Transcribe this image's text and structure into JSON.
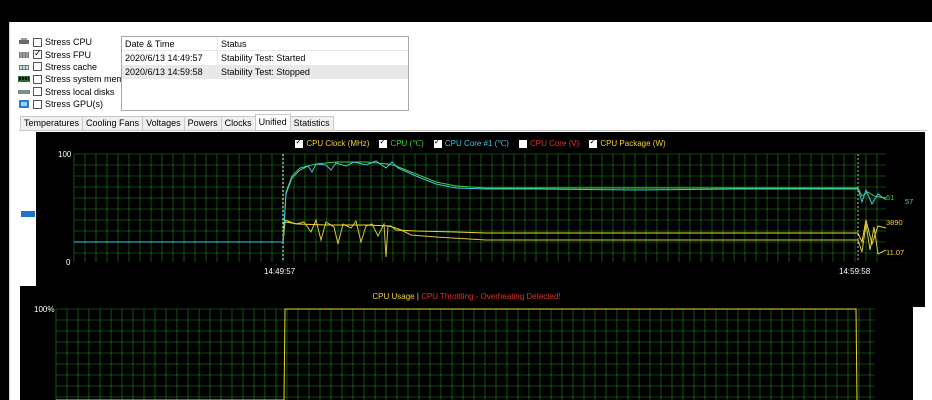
{
  "stress": [
    {
      "label": "Stress CPU",
      "checked": false,
      "icon": "cpu-icon"
    },
    {
      "label": "Stress FPU",
      "checked": true,
      "icon": "fpu-icon"
    },
    {
      "label": "Stress cache",
      "checked": false,
      "icon": "cache-icon"
    },
    {
      "label": "Stress system memo",
      "checked": false,
      "icon": "memory-icon"
    },
    {
      "label": "Stress local disks",
      "checked": false,
      "icon": "disk-icon"
    },
    {
      "label": "Stress GPU(s)",
      "checked": false,
      "icon": "gpu-icon"
    }
  ],
  "log": {
    "headers": [
      "Date & Time",
      "Status"
    ],
    "rows": [
      {
        "time": "2020/6/13 14:49:57",
        "status": "Stability Test: Started"
      },
      {
        "time": "2020/6/13 14:59:58",
        "status": "Stability Test: Stopped"
      }
    ]
  },
  "tabs": [
    "Temperatures",
    "Cooling Fans",
    "Voltages",
    "Powers",
    "Clocks",
    "Unified",
    "Statistics"
  ],
  "active_tab": "Unified",
  "chart1": {
    "legend": [
      {
        "label": "CPU Clock (MHz)",
        "color": "#f2d431",
        "checked": true
      },
      {
        "label": "CPU (℃)",
        "color": "#3fd13f",
        "checked": true
      },
      {
        "label": "CPU Core #1 (℃)",
        "color": "#42c6e8",
        "checked": true
      },
      {
        "label": "CPU Core (V)",
        "color": "#e0332b",
        "checked": false
      },
      {
        "label": "CPU Package (W)",
        "color": "#f2d431",
        "checked": true
      }
    ],
    "y_top": "100",
    "y_bottom": "0",
    "x_start": "14:49:57",
    "x_end": "14:59:58",
    "value_labels": [
      "61",
      "57",
      "3890",
      "11.07"
    ],
    "value_colors": [
      "#3fd13f",
      "#42c6e8",
      "#f2d431",
      "#f2d431"
    ]
  },
  "chart2": {
    "title_left": "CPU Usage",
    "separator": "|",
    "title_right": "CPU Throttling - Overheating Detected!",
    "left_color": "#f2d431",
    "right_color": "#e0332b",
    "y_top": "100%"
  },
  "colors": {
    "grid": "#1e8a1e",
    "accent": "#1f74c9"
  }
}
